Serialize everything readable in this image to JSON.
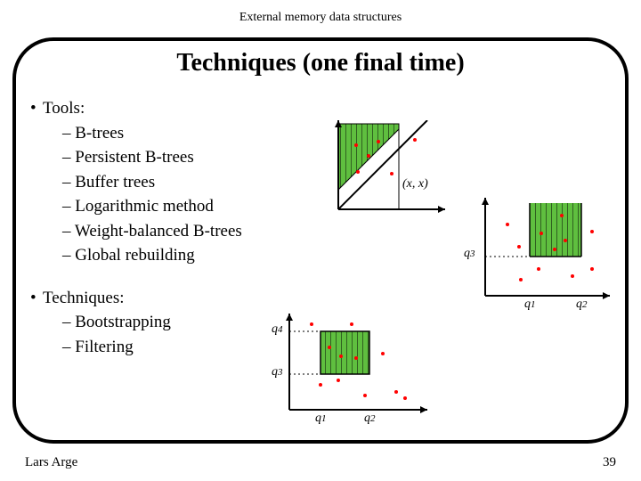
{
  "header": "External memory data structures",
  "title": "Techniques (one final time)",
  "tools": {
    "heading": "Tools:",
    "items": [
      "B-trees",
      "Persistent B-trees",
      "Buffer trees",
      "Logarithmic method",
      "Weight-balanced B-trees",
      "Global rebuilding"
    ]
  },
  "techniques": {
    "heading": "Techniques:",
    "items": [
      "Bootstrapping",
      "Filtering"
    ]
  },
  "footer": {
    "author": "Lars Arge",
    "page": "39"
  },
  "diagram_labels": {
    "d1_xx": "(x, x)",
    "d2_q3": "q",
    "d2_q3s": "3",
    "d2_q1": "q",
    "d2_q1s": "1",
    "d2_q2": "q",
    "d2_q2s": "2",
    "d3_q4": "q",
    "d3_q4s": "4",
    "d3_q3": "q",
    "d3_q3s": "3",
    "d3_q1": "q",
    "d3_q1s": "1",
    "d3_q2": "q",
    "d3_q2s": "2"
  }
}
